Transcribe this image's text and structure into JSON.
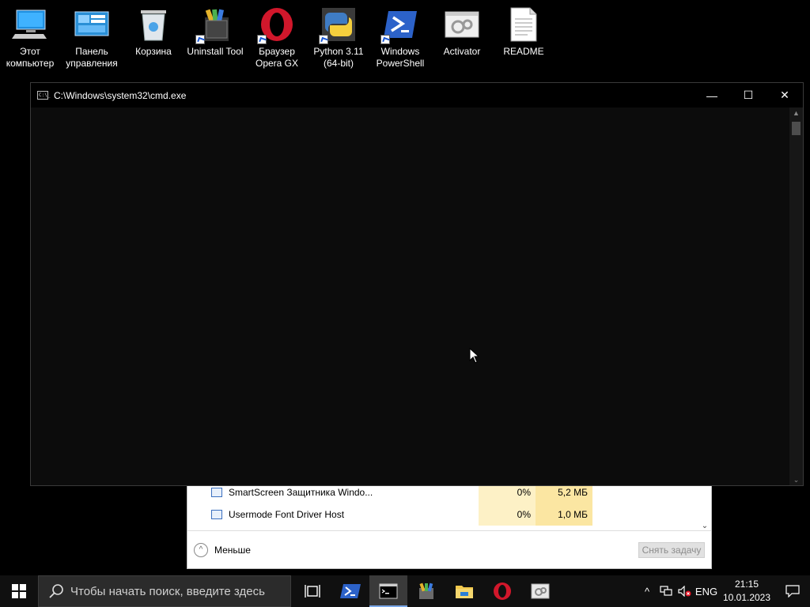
{
  "desktop": {
    "icons": [
      {
        "label": "Этот\nкомпьютер",
        "icon": "computer-icon"
      },
      {
        "label": "Панель\nуправления",
        "icon": "control-panel-icon"
      },
      {
        "label": "Корзина",
        "icon": "recycle-bin-icon"
      },
      {
        "label": "Uninstall Tool",
        "icon": "uninstall-tool-icon"
      },
      {
        "label": "Браузер\nOpera GX",
        "icon": "opera-icon"
      },
      {
        "label": "Python 3.11\n(64-bit)",
        "icon": "python-icon"
      },
      {
        "label": "Windows\nPowerShell",
        "icon": "powershell-icon"
      },
      {
        "label": "Activator",
        "icon": "activator-icon"
      },
      {
        "label": "README",
        "icon": "text-file-icon"
      }
    ]
  },
  "cmd": {
    "title": "C:\\Windows\\system32\\cmd.exe",
    "icon_text": "C:\\_",
    "minimize": "—",
    "maximize": "☐",
    "close": "✕"
  },
  "task_manager": {
    "rows": [
      {
        "name": "SmartScreen Защитника Windo...",
        "cpu": "0%",
        "memory": "5,2 МБ"
      },
      {
        "name": "Usermode Font Driver Host",
        "cpu": "0%",
        "memory": "1,0 МБ"
      }
    ],
    "less_label": "Меньше",
    "end_task_label": "Снять задачу"
  },
  "taskbar": {
    "search_placeholder": "Чтобы начать поиск, введите здесь",
    "pinned": [
      "task-view-icon",
      "powershell-icon",
      "cmd-icon",
      "winrar-icon",
      "file-explorer-icon",
      "opera-icon",
      "activator-icon"
    ],
    "language": "ENG",
    "time": "21:15",
    "date": "10.01.2023"
  }
}
